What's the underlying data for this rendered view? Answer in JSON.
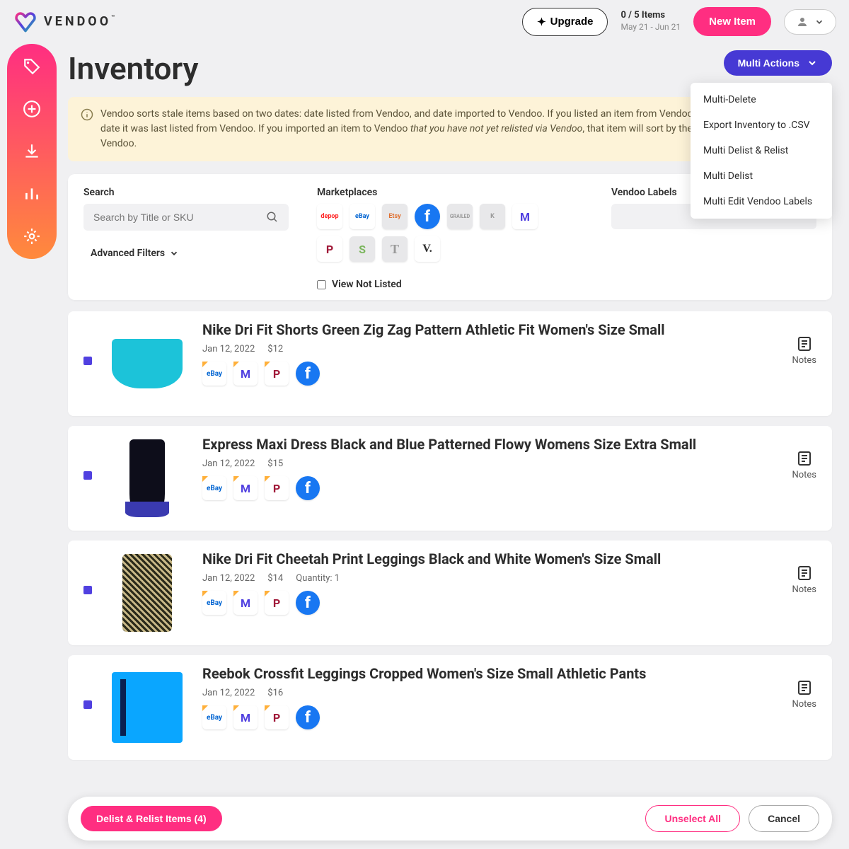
{
  "header": {
    "brand": "VENDOO",
    "upgrade": "Upgrade",
    "quota_line1": "0 / 5 Items",
    "quota_line2": "May 21 - Jun 21",
    "new_item": "New Item"
  },
  "page": {
    "title": "Inventory",
    "multi_actions_label": "Multi Actions"
  },
  "dropdown": {
    "items": [
      "Multi-Delete",
      "Export Inventory to .CSV",
      "Multi Delist & Relist",
      "Multi Delist",
      "Multi Edit Vendoo Labels"
    ]
  },
  "banner": {
    "text_a": "Vendoo sorts stale items based on two dates: date listed from Vendoo, and date imported to Vendoo. If you listed an item from Vendoo, then they will sort by the date it was last listed from Vendoo. If you imported an item to Vendoo ",
    "text_em": "that you have not yet relisted via Vendoo",
    "text_b": ", that item will sort by the date it was imported to Vendoo."
  },
  "filters": {
    "search_label": "Search",
    "search_placeholder": "Search by Title or SKU",
    "adv_label": "Advanced Filters",
    "marketplaces_label": "Marketplaces",
    "labels_label": "Vendoo Labels",
    "view_not_listed": "View Not Listed",
    "marketplaces": [
      "depop",
      "eBay",
      "Etsy",
      "f",
      "GRAILED",
      "K",
      "M",
      "P",
      "S",
      "T",
      "V."
    ]
  },
  "items": [
    {
      "title": "Nike Dri Fit Shorts Green Zig Zag Pattern Athletic Fit Women's Size Small",
      "date": "Jan 12, 2022",
      "price": "$12",
      "quantity": "",
      "notes_label": "Notes"
    },
    {
      "title": "Express Maxi Dress Black and Blue Patterned Flowy Womens Size Extra Small",
      "date": "Jan 12, 2022",
      "price": "$15",
      "quantity": "",
      "notes_label": "Notes"
    },
    {
      "title": "Nike Dri Fit Cheetah Print Leggings Black and White Women's Size Small",
      "date": "Jan 12, 2022",
      "price": "$14",
      "quantity": "Quantity: 1",
      "notes_label": "Notes"
    },
    {
      "title": "Reebok Crossfit Leggings Cropped Women's Size Small Athletic Pants",
      "date": "Jan 12, 2022",
      "price": "$16",
      "quantity": "",
      "notes_label": "Notes"
    }
  ],
  "listing_badges": [
    "eBay",
    "M",
    "P",
    "f"
  ],
  "bottom": {
    "primary": "Delist & Relist Items (4)",
    "unselect": "Unselect All",
    "cancel": "Cancel"
  }
}
